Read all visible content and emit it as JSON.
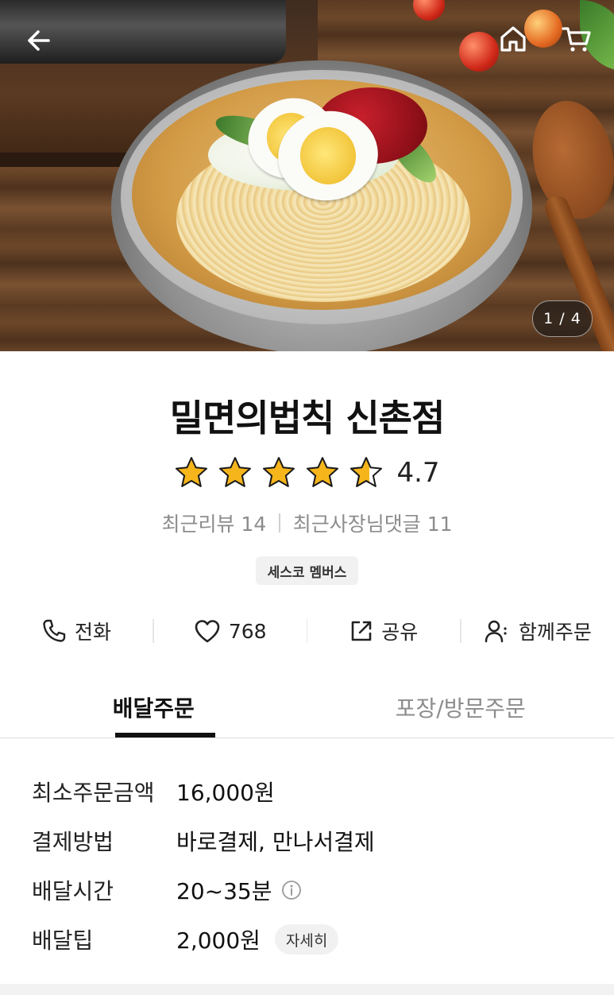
{
  "hero": {
    "counter": "1 / 4",
    "icons": {
      "back": "arrow-left-icon",
      "home": "home-icon",
      "cart": "cart-icon"
    }
  },
  "store": {
    "name": "밀면의법칙 신촌점",
    "rating": "4.7",
    "rating_value": 4.7,
    "stars_max": 5,
    "recent_reviews": "최근리뷰 14",
    "recent_owner_replies": "최근사장님댓글 11",
    "badge": "세스코 멤버스"
  },
  "actions": {
    "call": "전화",
    "likes": "768",
    "share": "공유",
    "group_order": "함께주문"
  },
  "tabs": {
    "delivery": "배달주문",
    "pickup": "포장/방문주문"
  },
  "info": {
    "min_order_label": "최소주문금액",
    "min_order_value": "16,000원",
    "payment_label": "결제방법",
    "payment_value": "바로결제, 만나서결제",
    "delivery_time_label": "배달시간",
    "delivery_time_value": "20~35분",
    "delivery_tip_label": "배달팁",
    "delivery_tip_value": "2,000원",
    "detail_button": "자세히"
  },
  "colors": {
    "star": "#f6b61b",
    "text": "#111111",
    "muted": "#8c8c8c",
    "chip_bg": "#f1f1f1"
  }
}
